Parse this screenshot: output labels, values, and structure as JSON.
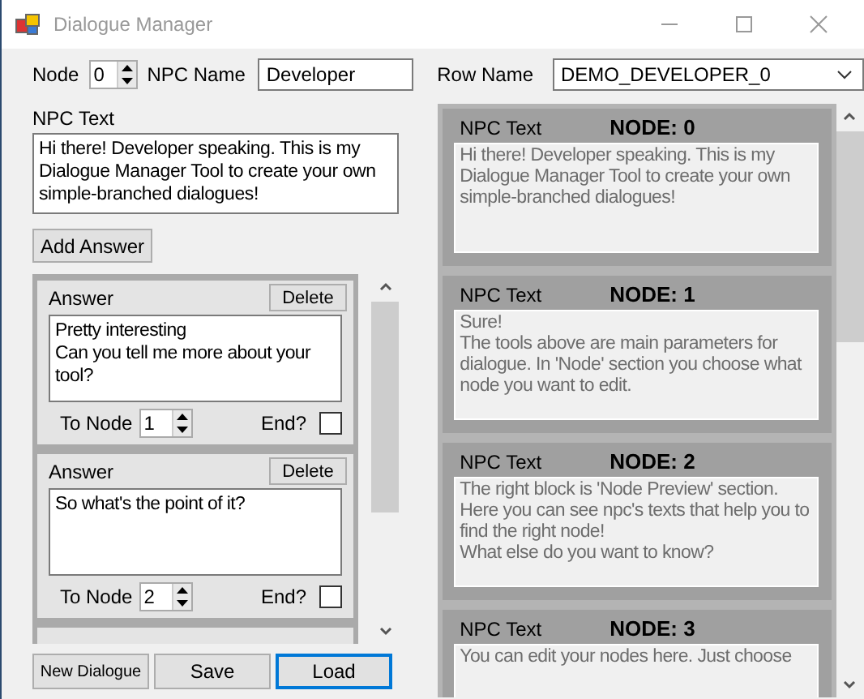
{
  "window": {
    "title": "Dialogue Manager"
  },
  "node": {
    "label": "Node",
    "value": "0"
  },
  "npc_name": {
    "label": "NPC Name",
    "value": "Developer"
  },
  "row_name": {
    "label": "Row Name",
    "value": "DEMO_DEVELOPER_0"
  },
  "npc_text": {
    "label": "NPC Text",
    "value": "Hi there! Developer speaking. This is my Dialogue Manager Tool to create your own simple-branched dialogues!"
  },
  "add_answer": "Add Answer",
  "answers": [
    {
      "label": "Answer",
      "delete": "Delete",
      "text": "Pretty interesting\nCan you tell me more about your tool?",
      "to_node_label": "To Node",
      "to_node": "1",
      "end_label": "End?",
      "end": false
    },
    {
      "label": "Answer",
      "delete": "Delete",
      "text": "So what's the point of it?",
      "to_node_label": "To Node",
      "to_node": "2",
      "end_label": "End?",
      "end": false
    }
  ],
  "buttons": [
    {
      "label": "New Dialogue",
      "kind": "small",
      "focused": false
    },
    {
      "label": "Save",
      "kind": "normal",
      "focused": false
    },
    {
      "label": "Load",
      "kind": "normal",
      "focused": true
    }
  ],
  "preview": [
    {
      "label": "NPC Text",
      "title": "NODE: 0",
      "text": "Hi there! Developer speaking. This is my Dialogue Manager Tool to create your own simple-branched dialogues!"
    },
    {
      "label": "NPC Text",
      "title": "NODE: 1",
      "text": "Sure!\nThe tools above are main parameters for dialogue. In 'Node' section you choose what node you want to edit."
    },
    {
      "label": "NPC Text",
      "title": "NODE: 2",
      "text": "The right block is 'Node Preview' section.\nHere you can see npc's texts that help you to find the right node!\nWhat else do you want to know?"
    },
    {
      "label": "NPC Text",
      "title": "NODE: 3",
      "text": "You can edit your nodes here. Just choose"
    }
  ]
}
